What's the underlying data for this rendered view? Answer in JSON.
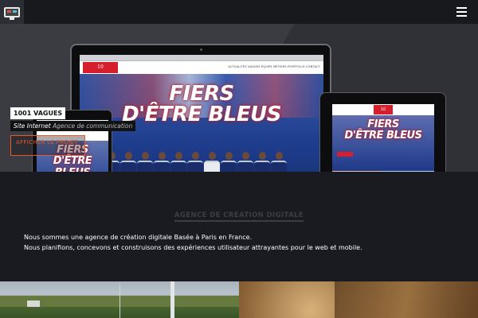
{
  "header": {
    "logo_icon": "monitor-logo-icon",
    "menu_icon": "hamburger-menu-icon"
  },
  "hero": {
    "client_tag": "1001 VAGUES",
    "project_type": "Site Internet",
    "project_agency": "Agence de communication",
    "cta_label": "AFFICHER LE PROJET",
    "mockup": {
      "site_logo": "10",
      "site_nav": "ACTUALITÉS  VAGUES  ÉQUIPE  MÉTIERS  PORTFOLIO  CONTACT",
      "headline_1": "FIERS",
      "headline_2": "D'ÊTRE BLEUS"
    }
  },
  "section": {
    "title": "AGENCE DE CRÉATION DIGITALE",
    "paragraph_line_1": "Nous sommes une agence de création digitale Basée à Paris en France.",
    "paragraph_line_2": "Nous planifions, concevons et construisons des expériences utilisateur attrayantes pour le web et mobile."
  },
  "colors": {
    "accent": "#e8572a",
    "brand_red": "#d61f2c",
    "background": "#1a1b20"
  }
}
